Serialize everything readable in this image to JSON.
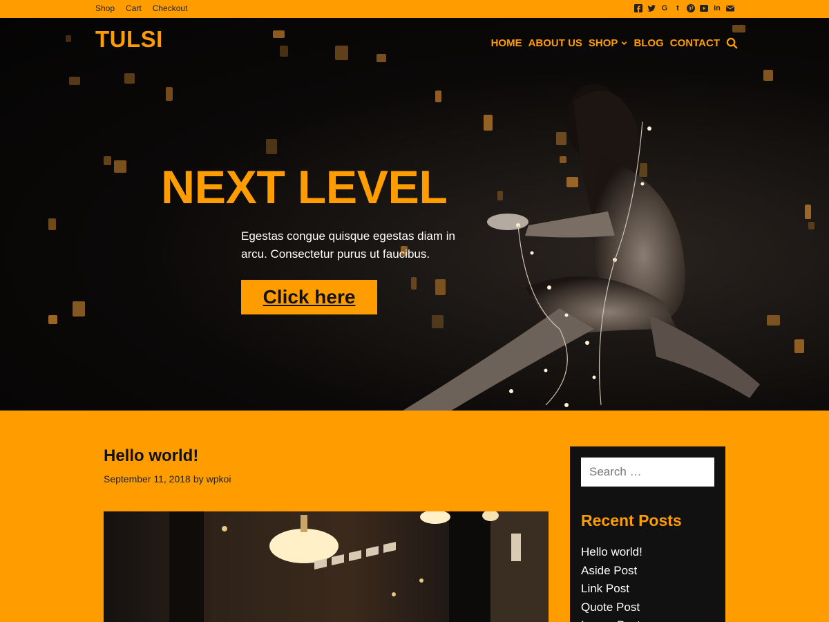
{
  "topbar": {
    "links": [
      "Shop",
      "Cart",
      "Checkout"
    ],
    "social_icons": [
      "facebook-icon",
      "twitter-icon",
      "google-plus-icon",
      "tumblr-icon",
      "pinterest-icon",
      "youtube-icon",
      "linkedin-icon",
      "email-icon"
    ]
  },
  "header": {
    "logo": "TULSI",
    "nav": [
      "HOME",
      "ABOUT US",
      "SHOP",
      "BLOG",
      "CONTACT"
    ]
  },
  "hero": {
    "title": "NEXT LEVEL",
    "text": "Egestas congue quisque egestas diam in arcu. Consectetur purus ut faucibus.",
    "button": "Click here"
  },
  "post": {
    "title": "Hello world!",
    "date": "September 11, 2018",
    "by": "by",
    "author": "wpkoi"
  },
  "sidebar": {
    "search_placeholder": "Search …",
    "recent_title": "Recent Posts",
    "recent_posts": [
      "Hello world!",
      "Aside Post",
      "Link Post",
      "Quote Post",
      "Image Post"
    ]
  },
  "colors": {
    "accent": "#ff9d00",
    "dark": "#111111"
  }
}
